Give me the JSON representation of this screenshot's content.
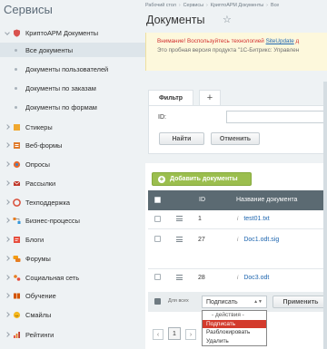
{
  "sidebar": {
    "title": "Сервисы",
    "items": [
      {
        "label": "КриптоАРМ Документы",
        "icon": "shield-icon",
        "expanded": true
      },
      {
        "label": "Все документы",
        "sub": true,
        "active": true
      },
      {
        "label": "Документы пользователей",
        "sub": true
      },
      {
        "label": "Документы по заказам",
        "sub": true
      },
      {
        "label": "Документы по формам",
        "sub": true
      },
      {
        "label": "Стикеры",
        "icon": "sticker-icon"
      },
      {
        "label": "Веб-формы",
        "icon": "form-icon"
      },
      {
        "label": "Опросы",
        "icon": "poll-icon"
      },
      {
        "label": "Рассылки",
        "icon": "mail-icon"
      },
      {
        "label": "Техподдержка",
        "icon": "support-icon"
      },
      {
        "label": "Бизнес-процессы",
        "icon": "process-icon"
      },
      {
        "label": "Блоги",
        "icon": "blog-icon"
      },
      {
        "label": "Форумы",
        "icon": "forum-icon"
      },
      {
        "label": "Социальная сеть",
        "icon": "social-icon"
      },
      {
        "label": "Обучение",
        "icon": "learning-icon"
      },
      {
        "label": "Смайлы",
        "icon": "smile-icon"
      },
      {
        "label": "Рейтинги",
        "icon": "rating-icon"
      }
    ]
  },
  "breadcrumb": [
    "Рабочий стол",
    "Сервисы",
    "КриптоАРМ Документы",
    "Все"
  ],
  "page": {
    "title": "Документы"
  },
  "notice": {
    "warning": "Внимание! Воспользуйтесь технологией ",
    "link": "SiteUpdate",
    "warning_tail": " д",
    "line2": "Это пробная версия продукта \"1С-Битрикс: Управлен"
  },
  "filter": {
    "tab_label": "Фильтр",
    "add_label": "+",
    "id_label": "ID:",
    "find_button": "Найти",
    "cancel_button": "Отменить"
  },
  "grid": {
    "add_button": "Добавить документы",
    "columns": {
      "id": "ID",
      "name": "Название документа"
    },
    "rows": [
      {
        "id": "1",
        "name": "test01.txt"
      },
      {
        "id": "27",
        "name": "Doc1.odt.sig"
      },
      {
        "id": "28",
        "name": "Doc3.odt"
      }
    ]
  },
  "footer": {
    "for_all": "Для всех",
    "action_selected": "Подписать",
    "apply_button": "Применить",
    "dropdown_options": [
      "- действия -",
      "Подписать",
      "Разблокировать",
      "Удалить"
    ],
    "selected_index": 1
  },
  "pager": {
    "current_page": "1",
    "prev": "‹",
    "next": "›"
  },
  "colors": {
    "accent_green": "#9bbe4e",
    "header_gray": "#5b6a72",
    "link_blue": "#2067b0",
    "selected_red": "#d33a2c"
  }
}
